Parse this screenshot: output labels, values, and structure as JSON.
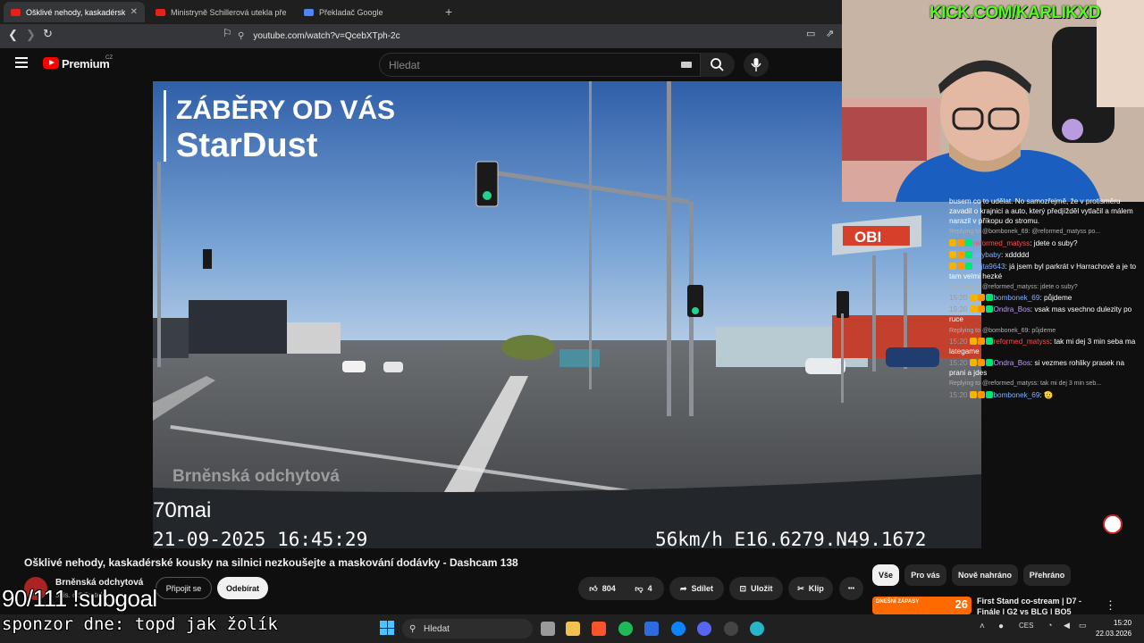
{
  "browser": {
    "tabs": [
      {
        "label": "Ošklivé nehody, kaskadérské kou"
      },
      {
        "label": "Ministryně Schillerová utekla před ot"
      },
      {
        "label": "Překladač Google"
      }
    ],
    "new_tab": "+",
    "close": "✕",
    "url": "youtube.com/watch?v=QcebXTph-2c"
  },
  "youtube": {
    "brand": "Premium",
    "country": "CZ",
    "search_placeholder": "Hledat"
  },
  "video": {
    "overlay_heading": "ZÁBĚRY OD VÁS",
    "overlay_name": "StarDust",
    "watermark": "Brněnská odchytová",
    "cam_brand": "70mai",
    "timestamp": "21-09-2025 16:45:29",
    "speed_gps": "56km/h E16.6279.N49.1672",
    "sign": "OBI",
    "title": "Ošklivé nehody, kaskadérské kousky na silnici nezkoušejte a maskování dodávky - Dashcam 138",
    "channel": "Brněnská odchytová",
    "subs": "5 tis. odběratelů",
    "join": "Připojit se",
    "subscribe": "Odebírat",
    "likes": "804",
    "dislikes": "4",
    "share": "Sdílet",
    "save": "Uložit",
    "clip": "Klip",
    "more": "•••"
  },
  "sidebar": {
    "chips": [
      "Vše",
      "Pro vás",
      "Nově nahráno",
      "Přehráno"
    ],
    "reco_badge": "DNEŠNÍ ZÁPASY",
    "reco_number": "26",
    "reco_title": "First Stand co-stream | D7 - Finále | G2 vs BLG | BO5"
  },
  "stream": {
    "kick": "KICK.COM/KARLIKXD",
    "subgoal": "90/111 !subgoal",
    "sponsor": "sponzor dne: topd jak žolík"
  },
  "chat": [
    {
      "kind": "text",
      "text": "busem co to udělat. No samozřejmě, že v protisměru zavadil o krajnici a auto, který předjížděl vytlačil a málem narazil v příkopu do stromu."
    },
    {
      "kind": "reply",
      "text": "Replying to @bombonek_69: @reformed_matyss po..."
    },
    {
      "kind": "msg",
      "time": "",
      "user": "reformed_matyss",
      "cls": "u1",
      "text": "jdete o suby?"
    },
    {
      "kind": "msg",
      "time": "",
      "user": "abybaby",
      "cls": "u2",
      "text": "xddddd"
    },
    {
      "kind": "msg",
      "time": "",
      "user": "vojta9643",
      "cls": "u2",
      "text": "já jsem byl parkrát v Harrachově a je to tam velmi hezké"
    },
    {
      "kind": "reply",
      "text": "Replying to @reformed_matyss: jdete o suby?"
    },
    {
      "kind": "msg",
      "time": "15:20",
      "user": "bombonek_69",
      "cls": "u2",
      "text": "půjdeme"
    },
    {
      "kind": "msg",
      "time": "15:20",
      "user": "Ondra_Bos",
      "cls": "u4",
      "text": "vsak mas vsechno dulezity po ruce"
    },
    {
      "kind": "reply",
      "text": "Replying to @bombonek_69: půjdeme"
    },
    {
      "kind": "msg",
      "time": "15:20",
      "user": "reformed_matyss",
      "cls": "u1",
      "text": "tak mi dej 3 min seba ma lategame"
    },
    {
      "kind": "msg",
      "time": "15:20",
      "user": "Ondra_Bos",
      "cls": "u4",
      "text": "si vezmes rohliky prasek na prani a jdes"
    },
    {
      "kind": "reply",
      "text": "Replying to @reformed_matyss: tak mi dej 3 min seb..."
    },
    {
      "kind": "msg",
      "time": "15:20",
      "user": "bombonek_69",
      "cls": "u2",
      "text": "🫡"
    }
  ],
  "taskbar": {
    "search": "Hledat",
    "lang": "CES",
    "time": "15:20",
    "date": "22.03.2026"
  }
}
